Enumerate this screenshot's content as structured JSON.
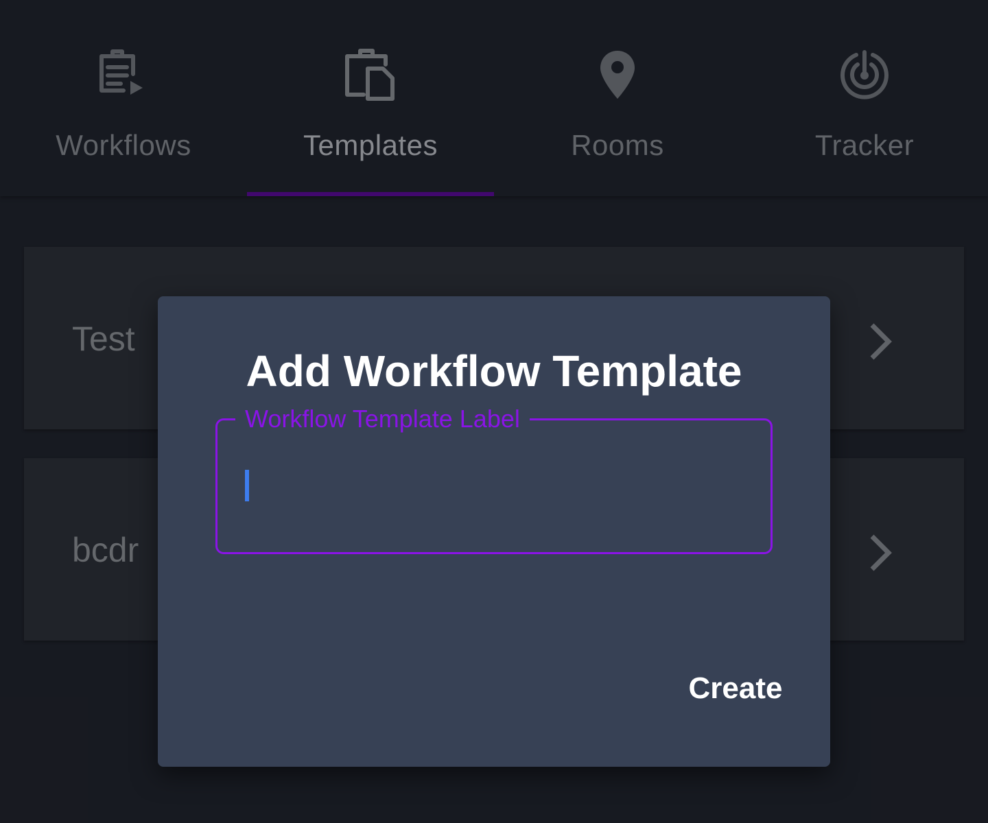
{
  "tabs": [
    {
      "label": "Workflows",
      "icon": "clipboard-play-icon",
      "active": false
    },
    {
      "label": "Templates",
      "icon": "clipboard-file-icon",
      "active": true
    },
    {
      "label": "Rooms",
      "icon": "map-pin-icon",
      "active": false
    },
    {
      "label": "Tracker",
      "icon": "radar-icon",
      "active": false
    }
  ],
  "templates": [
    {
      "name": "Test"
    },
    {
      "name": "bcdr"
    }
  ],
  "dialog": {
    "title": "Add Workflow Template",
    "field_label": "Workflow Template Label",
    "field_value": "",
    "create_label": "Create"
  },
  "colors": {
    "background": "#1b1e26",
    "card": "#25282f",
    "dialog": "#374155",
    "accent_purple": "#8a14e6",
    "tab_indicator": "#4b0a7e",
    "caret": "#3d7df0"
  }
}
